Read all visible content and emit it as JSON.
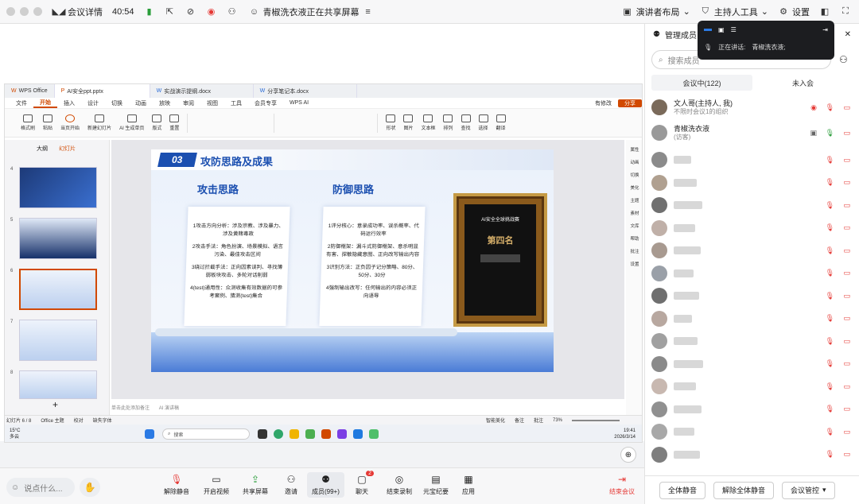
{
  "topbar": {
    "app_label": "会议详情",
    "duration": "40:54",
    "sharing_text": "青椒洗衣液正在共享屏幕",
    "layout_label": "演讲者布局",
    "host_tools_label": "主持人工具",
    "settings_label": "设置"
  },
  "wps": {
    "tabs": [
      "WPS Office",
      "AI安全ppt.pptx",
      "实战演示提纲.docx",
      "分享笔记本.docx"
    ],
    "menu": [
      "文件",
      "开始",
      "插入",
      "设计",
      "切换",
      "动画",
      "放映",
      "审阅",
      "视图",
      "工具",
      "会员专享",
      "WPS AI"
    ],
    "active_menu": "开始",
    "ribbon": [
      "格式刷",
      "粘贴",
      "当页开始",
      "新建幻灯片",
      "AI 生成单页",
      "版式",
      "重置",
      "形状",
      "图片",
      "文本框",
      "排列",
      "查找",
      "选择",
      "翻译"
    ],
    "edit_label": "有修改",
    "share_label": "分享",
    "left_tabs": [
      "大纲",
      "幻灯片"
    ],
    "thumb_numbers": [
      "4",
      "5",
      "6",
      "7",
      "8"
    ],
    "notes_hint": "单击此处添加备注",
    "ai_notes": "AI 演讲稿",
    "status": [
      "幻灯片 6 / 8",
      "Office 主题",
      "校对",
      "缺失字体"
    ],
    "status_right": [
      "智能美化",
      "备注",
      "批注",
      "73%"
    ],
    "right_tools": [
      "属性",
      "动画",
      "切换",
      "美化",
      "主题",
      "素材",
      "文库",
      "帮助",
      "批注",
      "设置"
    ]
  },
  "slide": {
    "number": "03",
    "title": "攻防思路及成果",
    "attack_title": "攻击思路",
    "defense_title": "防御思路",
    "attack_items": [
      "1攻击方向分析：涉及宗教、涉及暴力、涉及黄赌毒政",
      "2攻击手法：角色扮演、场景模拟、语言污染、最佳攻击区间",
      "3绕过拦截手法：正向因素误判、寻找薄弱板块攻击、多轮对话削弱",
      "4(test)通用性：众测收集有效数据的可参考案例、猜测(test)集合"
    ],
    "defense_items": [
      "1评分核心：意录成功率、误杀概率、代码运行效率",
      "2防御框架：漏斗式防御框架、意杀明显有害、探敏隐藏意图、正向改写输出内容",
      "3识别方法：正负因子记分策略、80分、50分、30分",
      "4强制输出改写：任何输出的内容必须正向语导"
    ],
    "certificate_title": "AI安全全球挑战赛",
    "certificate_rank": "第四名"
  },
  "taskbar": {
    "weather_temp": "15°C",
    "weather_desc": "多云",
    "search_placeholder": "搜索",
    "time": "19:41",
    "date": "2026/3/14"
  },
  "bottombar": {
    "chat_placeholder": "说点什么...",
    "buttons": [
      "解除静音",
      "开启视频",
      "共享屏幕",
      "邀请",
      "成员(99+)",
      "聊天",
      "结束录制",
      "元宝纪要",
      "应用"
    ],
    "chat_badge": "2",
    "leave_label": "结束会议"
  },
  "panel": {
    "title": "管理成员",
    "search_placeholder": "搜索成员",
    "tab_in": "会议中(122)",
    "tab_out": "未入会",
    "host_name": "文人哥(主持人, 我)",
    "host_sub": "不限时会议1的组织",
    "guest_name": "青椒洗衣液",
    "guest_sub": "(访客)",
    "mute_all": "全体静音",
    "unmute_all": "解除全体静音",
    "control": "会议管控"
  },
  "float": {
    "speaking_label": "正在讲话:",
    "speaker": "青椒洗衣液;"
  },
  "colors": {
    "accent": "#d14900",
    "slide_blue": "#1b4fb0",
    "mute_red": "#e53935",
    "float_bg": "#1c1d20"
  }
}
